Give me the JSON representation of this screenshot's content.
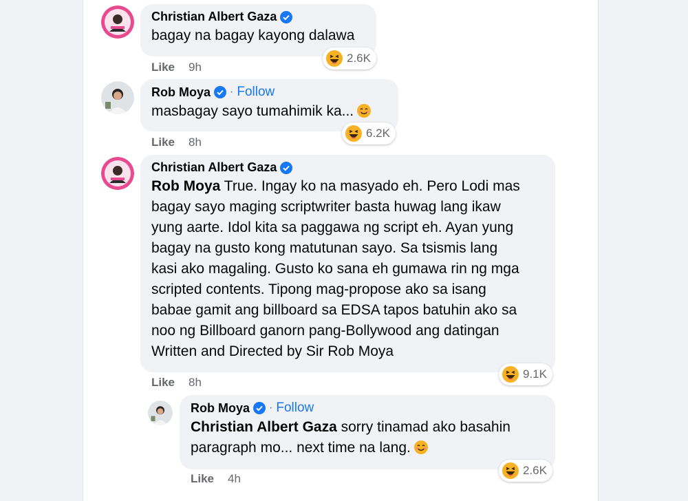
{
  "colors": {
    "bubble": "#f0f2f5",
    "link": "#1877f2",
    "meta": "#65676b",
    "verified": "#1877f2"
  },
  "comments": [
    {
      "author": "Christian Albert Gaza",
      "verified": true,
      "text": "bagay na bagay kayong dalawa",
      "like_label": "Like",
      "time": "9h",
      "reaction_icon": "laughing-emoji-icon",
      "reaction_count": "2.6K"
    },
    {
      "author": "Rob Moya",
      "verified": true,
      "follow_sep": "·",
      "follow_label": "Follow",
      "text": "masbagay sayo tumahimik ka...",
      "text_emoji": "smiling-emoji-icon",
      "like_label": "Like",
      "time": "8h",
      "reaction_icon": "laughing-emoji-icon",
      "reaction_count": "6.2K"
    },
    {
      "author": "Christian Albert Gaza",
      "verified": true,
      "mention": "Rob Moya",
      "lines": [
        " True. Ingay ko na masyado eh. Pero Lodi mas",
        "bagay sayo maging scriptwriter basta huwag lang ikaw",
        "yung aarte. Idol kita sa paggawa ng script eh. Ayan yung",
        "bagay na gusto kong matutunan sayo. Sa tsismis lang",
        "kasi ako magaling. Gusto ko sana eh gumawa rin ng mga",
        "scripted contents. Tipong mag-propose ako sa isang",
        "babae gamit ang billboard sa EDSA tapos batuhin ako sa",
        "noo ng Billboard ganorn pang-Bollywood ang datingan",
        "Written and Directed by Sir Rob Moya"
      ],
      "like_label": "Like",
      "time": "8h",
      "reaction_icon": "laughing-emoji-icon",
      "reaction_count": "9.1K"
    },
    {
      "author": "Rob Moya",
      "verified": true,
      "follow_sep": "·",
      "follow_label": "Follow",
      "mention": "Christian Albert Gaza",
      "line1": " sorry tinamad ako basahin",
      "line2": "paragraph mo... next time na lang.",
      "text_emoji": "smiling-emoji-icon",
      "like_label": "Like",
      "time": "4h",
      "reaction_icon": "laughing-emoji-icon",
      "reaction_count": "2.6K"
    }
  ]
}
